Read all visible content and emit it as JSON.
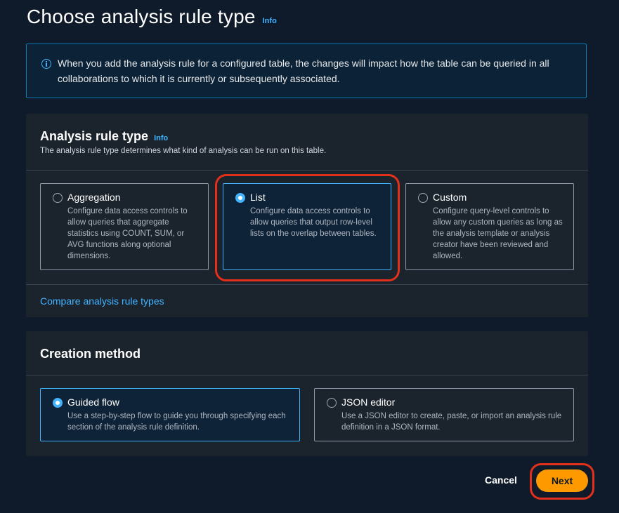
{
  "page": {
    "title": "Choose analysis rule type",
    "info": "Info"
  },
  "alert": {
    "icon": "info-circle-icon",
    "text": "When you add the analysis rule for a configured table, the changes will impact how the table can be queried in all collaborations to which it is currently or subsequently associated."
  },
  "rule_type": {
    "title": "Analysis rule type",
    "info": "Info",
    "description": "The analysis rule type determines what kind of analysis can be run on this table.",
    "selected": "List",
    "options": [
      {
        "label": "Aggregation",
        "description": "Configure data access controls to allow queries that aggregate statistics using COUNT, SUM, or AVG functions along optional dimensions."
      },
      {
        "label": "List",
        "description": "Configure data access controls to allow queries that output row-level lists on the overlap between tables."
      },
      {
        "label": "Custom",
        "description": "Configure query-level controls to allow any custom queries as long as the analysis template or analysis creator have been reviewed and allowed."
      }
    ],
    "compare_link": "Compare analysis rule types"
  },
  "creation_method": {
    "title": "Creation method",
    "selected": "Guided flow",
    "options": [
      {
        "label": "Guided flow",
        "description": "Use a step-by-step flow to guide you through specifying each section of the analysis rule definition."
      },
      {
        "label": "JSON editor",
        "description": "Use a JSON editor to create, paste, or import an analysis rule definition in a JSON format."
      }
    ]
  },
  "footer": {
    "cancel_label": "Cancel",
    "next_label": "Next"
  },
  "colors": {
    "accent": "#42b4ff",
    "primary_button": "#ff9900",
    "highlight": "#e2301a"
  }
}
